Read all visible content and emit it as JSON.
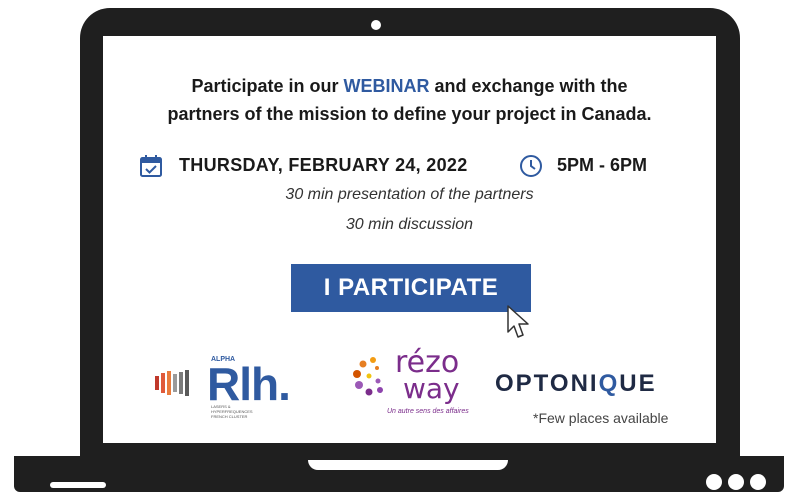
{
  "headline": {
    "line1_pre": "Participate in our ",
    "line1_accent": "WEBINAR",
    "line1_post": " and exchange with the",
    "line2": "partners of the mission to define your project in Canada."
  },
  "event": {
    "date": "THURSDAY, FEBRUARY 24, 2022",
    "time": "5PM - 6PM",
    "detail1": "30 min presentation of the partners",
    "detail2": "30 min discussion"
  },
  "cta": {
    "label": "I PARTICIPATE"
  },
  "logos": {
    "rlh": {
      "small": "ALPHA",
      "word": "Rlh.",
      "tagline": "LASERS & HYPERFREQUENCES FRENCH CLUSTER"
    },
    "rezo": {
      "top": "rézo",
      "bottom": "way",
      "tagline": "Un autre sens des affaires"
    },
    "opto": {
      "pre": "OPTONI",
      "q": "Q",
      "post": "UE"
    }
  },
  "footnote": "*Few places available",
  "colors": {
    "accent": "#2f5aa0",
    "frame": "#1f1f1f",
    "rezo": "#7b2d8b"
  },
  "icons": [
    "calendar-check-icon",
    "clock-icon",
    "cursor-icon"
  ]
}
